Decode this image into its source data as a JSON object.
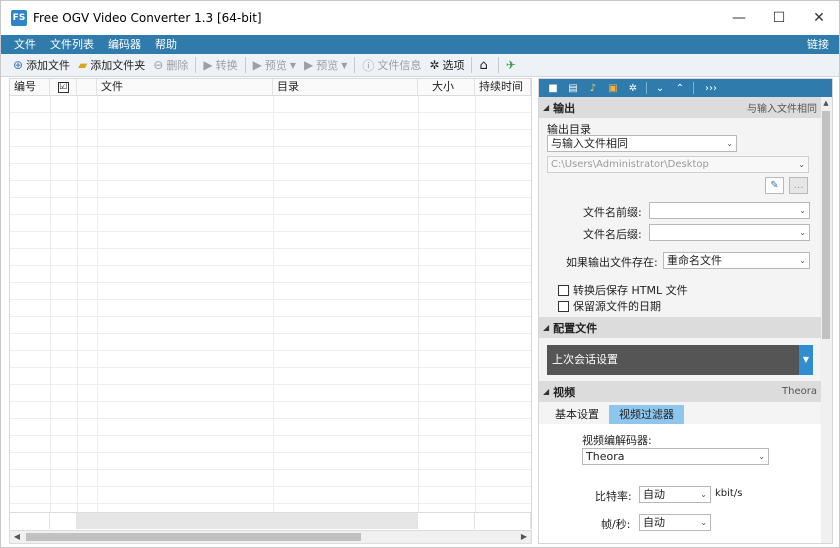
{
  "window": {
    "title": "Free OGV Video Converter 1.3  [64-bit]",
    "icon_text": "FS",
    "controls": {
      "minimize": "—",
      "maximize": "☐",
      "close": "✕"
    }
  },
  "menu": {
    "items": [
      "文件",
      "文件列表",
      "编码器",
      "帮助"
    ],
    "right": "链接"
  },
  "toolbar": {
    "add_file": "添加文件",
    "add_folder": "添加文件夹",
    "delete": "删除",
    "convert": "转换",
    "preview1": "预览",
    "preview2": "预览",
    "file_info": "文件信息",
    "options": "选项"
  },
  "list": {
    "columns": [
      "编号",
      "☑",
      "",
      "文件",
      "目录",
      "大小",
      "持续时间"
    ]
  },
  "right_panel": {
    "toolbar_icons": [
      "■",
      "▤",
      "♪",
      "▣",
      "✲",
      "⌄",
      "⌃",
      "›››"
    ],
    "output": {
      "title": "输出",
      "summary": "与输入文件相同",
      "dir_label": "输出目录",
      "dir_mode": "与输入文件相同",
      "dir_path": "C:\\Users\\Administrator\\Desktop",
      "prefix_label": "文件名前缀:",
      "prefix_value": "",
      "suffix_label": "文件名后缀:",
      "suffix_value": "",
      "exists_label": "如果输出文件存在:",
      "exists_value": "重命名文件",
      "save_html": "转换后保存 HTML 文件",
      "keep_date": "保留源文件的日期"
    },
    "profile": {
      "title": "配置文件",
      "value": "上次会话设置"
    },
    "video": {
      "title": "视频",
      "summary": "Theora",
      "tabs": [
        "基本设置",
        "视频过滤器"
      ],
      "codec_label": "视频编解码器:",
      "codec_value": "Theora",
      "bitrate_label": "比特率:",
      "bitrate_value": "自动",
      "bitrate_unit": "kbit/s",
      "fps_label": "帧/秒:",
      "fps_value": "自动"
    }
  }
}
